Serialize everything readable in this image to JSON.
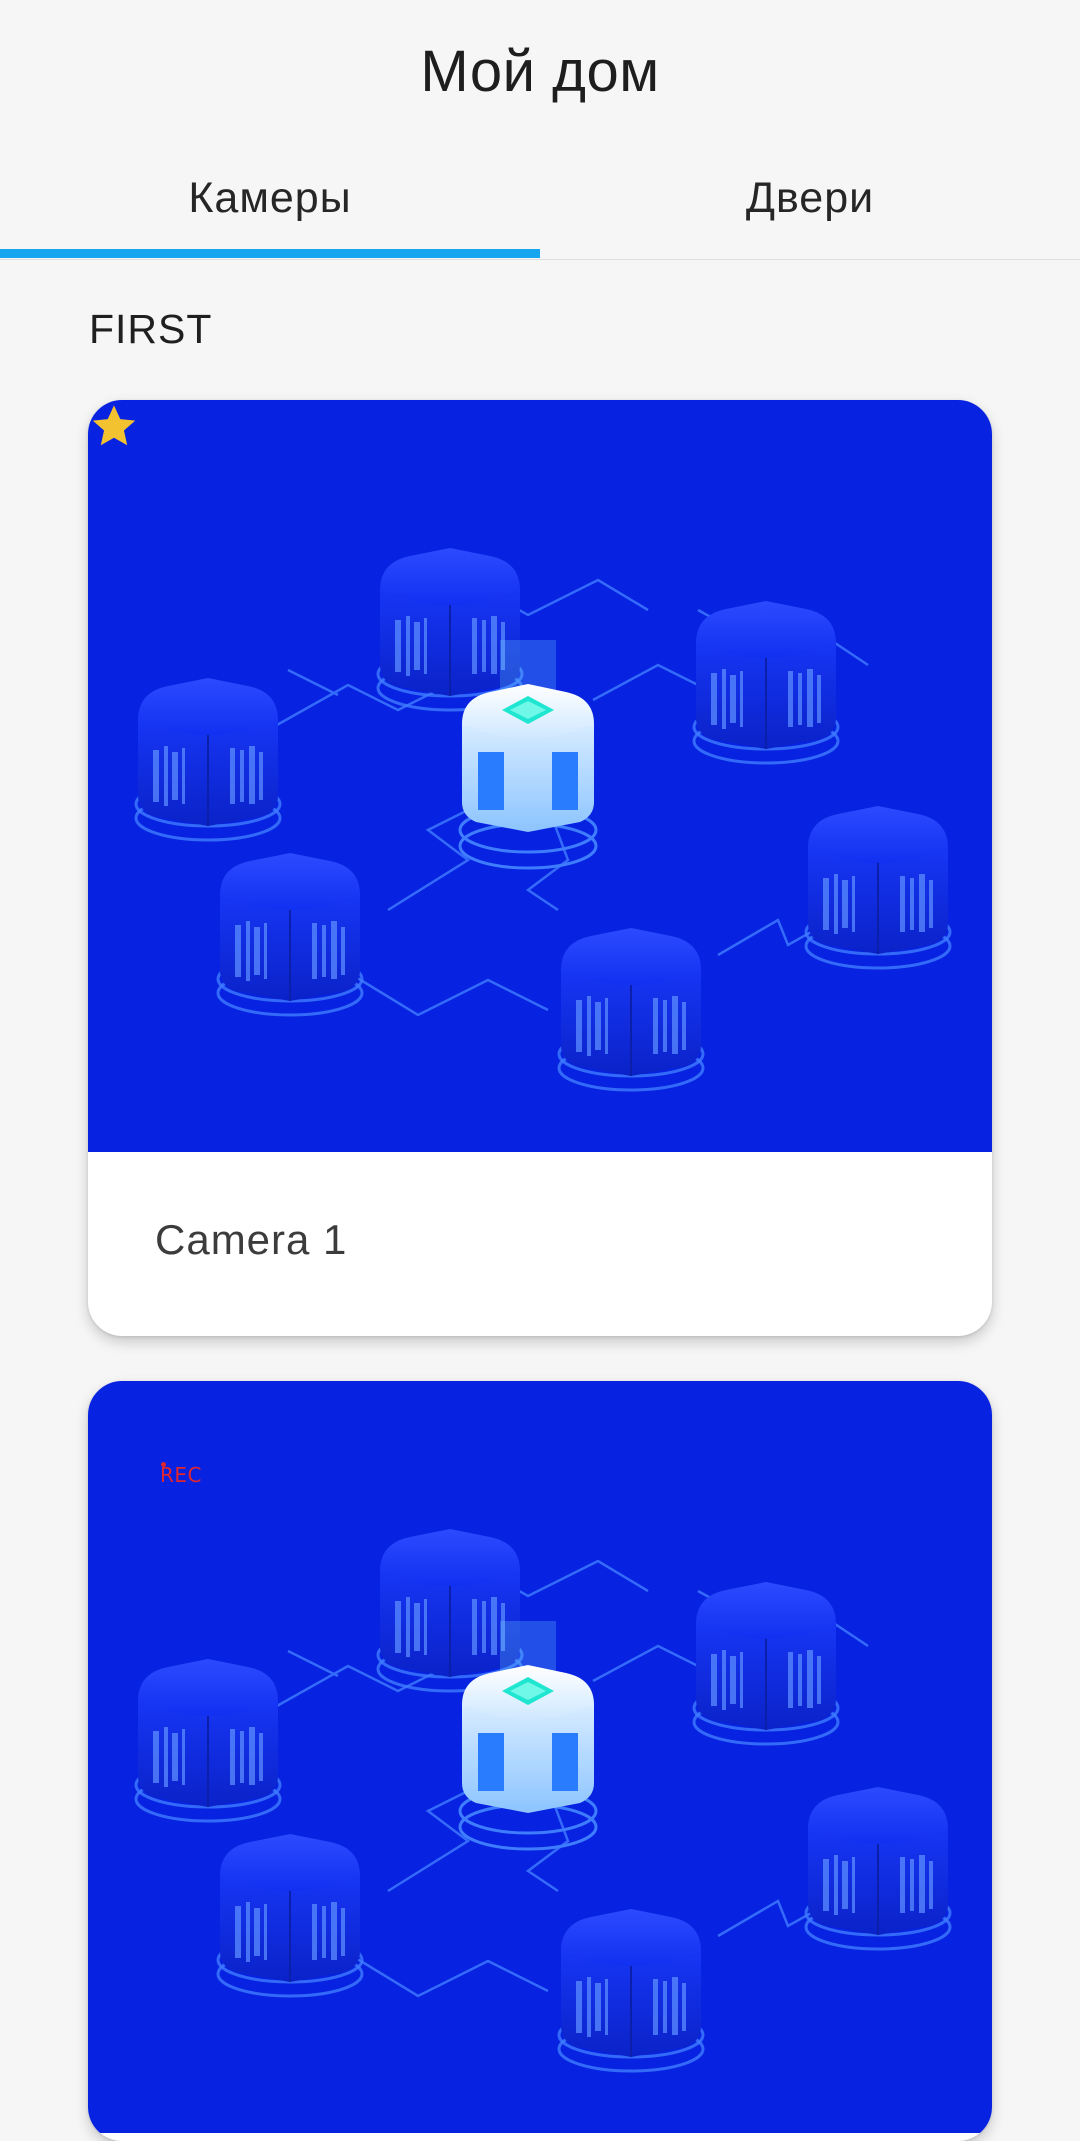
{
  "header": {
    "title": "Мой дом"
  },
  "tabs": [
    {
      "label": "Камеры",
      "active": true
    },
    {
      "label": "Двери",
      "active": false
    }
  ],
  "colors": {
    "accent": "#16a6ef",
    "preview_bg": "#0722e0",
    "favorite": "#f2c230",
    "rec": "#e0262e"
  },
  "section": {
    "label": "FIRST"
  },
  "cameras": [
    {
      "name": "Camera 1",
      "favorite": true,
      "favorite_icon": "star-icon"
    },
    {
      "name": "",
      "recording": true,
      "rec_label": "REC"
    }
  ]
}
